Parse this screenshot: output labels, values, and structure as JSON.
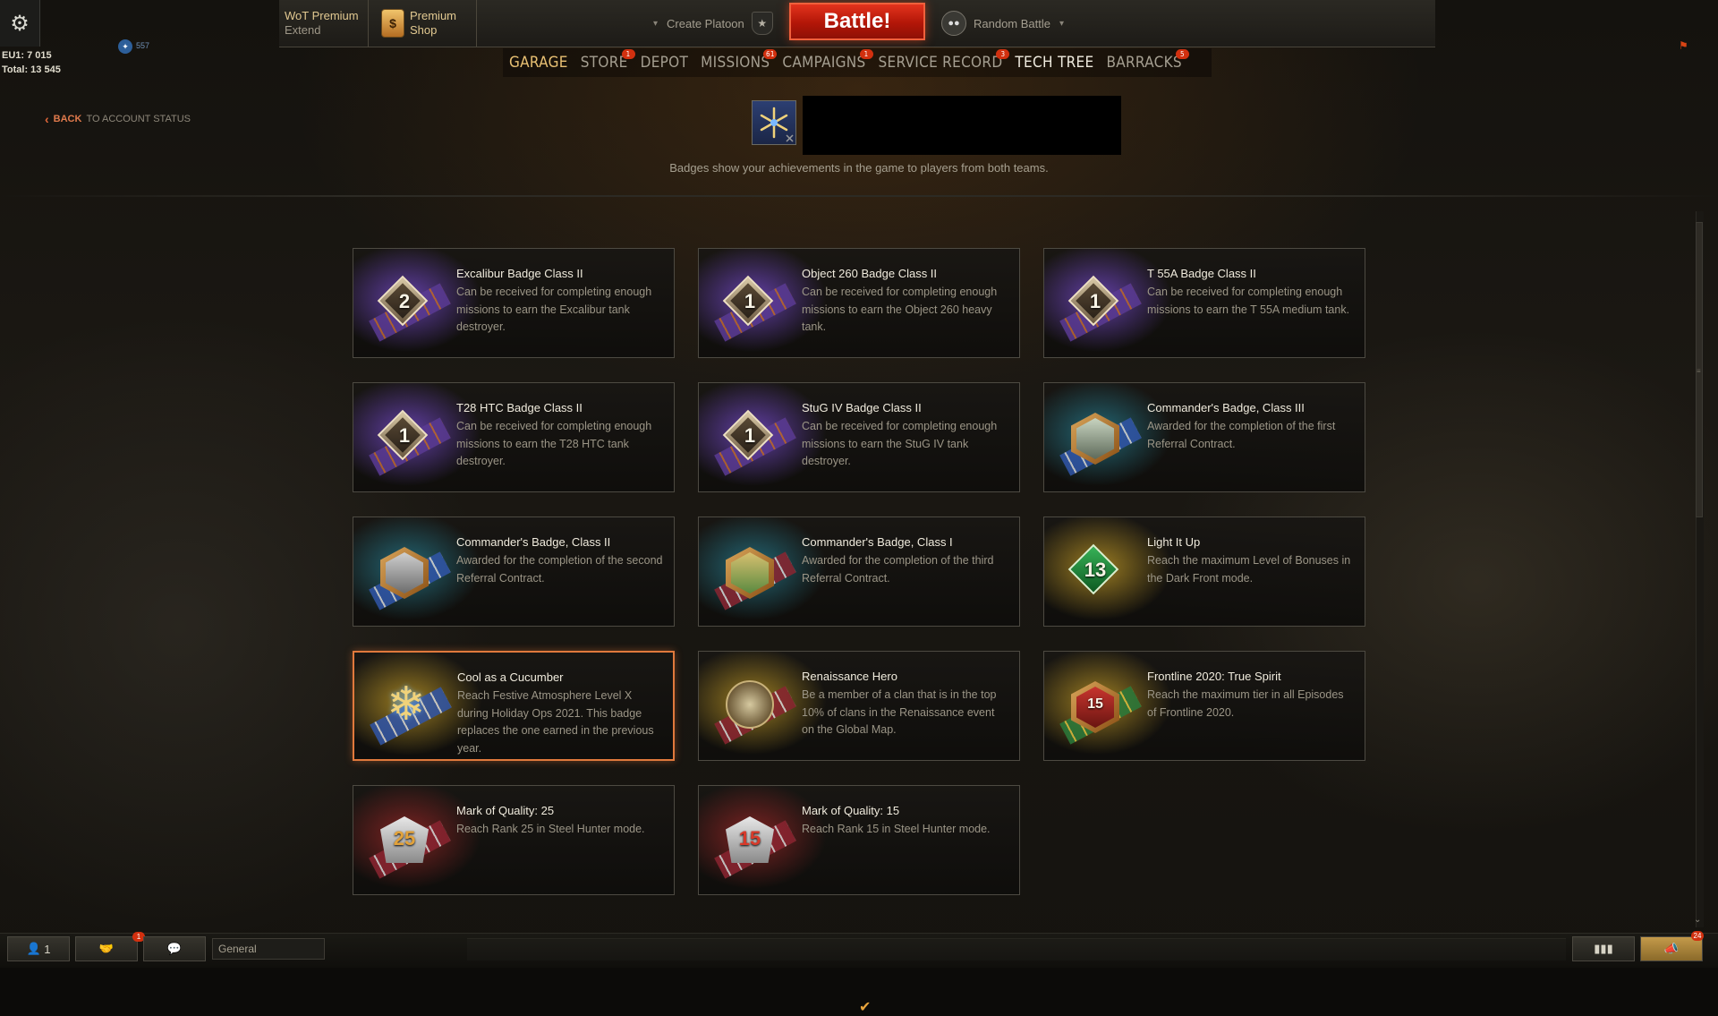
{
  "topbar": {
    "premium": {
      "title": "WoT Premium",
      "sub": "Extend"
    },
    "shop": {
      "title": "Premium",
      "sub": "Shop"
    },
    "platoon_label": "Create Platoon",
    "battle_label": "Battle!",
    "mode_label": "Random Battle"
  },
  "stats": {
    "line1": "EU1: 7 015",
    "line2": "Total: 13 545",
    "xp_value": "557"
  },
  "nav": {
    "items": [
      {
        "label": "GARAGE",
        "badge": ""
      },
      {
        "label": "STORE",
        "badge": "1"
      },
      {
        "label": "DEPOT",
        "badge": ""
      },
      {
        "label": "MISSIONS",
        "badge": "61"
      },
      {
        "label": "CAMPAIGNS",
        "badge": "1"
      },
      {
        "label": "SERVICE RECORD",
        "badge": "3"
      },
      {
        "label": "TECH TREE",
        "badge": ""
      },
      {
        "label": "BARRACKS",
        "badge": "5"
      }
    ]
  },
  "back": {
    "label": "BACK",
    "target": "TO ACCOUNT STATUS"
  },
  "header": {
    "caption": "Badges show your achievements in the game to players from both teams."
  },
  "badges": [
    {
      "title": "Excalibur Badge Class II",
      "desc": "Can be received for completing enough missions to earn the Excalibur tank destroyer.",
      "icon": "rank-2-badge-icon",
      "num": "2"
    },
    {
      "title": "Object 260 Badge Class II",
      "desc": "Can be received for completing enough missions to earn the Object 260 heavy tank.",
      "icon": "rank-1-badge-icon",
      "num": "1"
    },
    {
      "title": "T 55A Badge Class II",
      "desc": "Can be received for completing enough missions to earn the T 55A medium tank.",
      "icon": "rank-1-badge-icon",
      "num": "1"
    },
    {
      "title": "T28 HTC Badge Class II",
      "desc": "Can be received for completing enough missions to earn the T28 HTC tank destroyer.",
      "icon": "rank-1-badge-icon",
      "num": "1"
    },
    {
      "title": "StuG IV Badge Class II",
      "desc": "Can be received for completing enough missions to earn the StuG IV tank destroyer.",
      "icon": "rank-1-badge-icon",
      "num": "1"
    },
    {
      "title": "Commander's Badge, Class III",
      "desc": "Awarded for the completion of the first Referral Contract.",
      "icon": "commander-badge-icon",
      "num": ""
    },
    {
      "title": "Commander's Badge, Class II",
      "desc": "Awarded for the completion of the second Referral Contract.",
      "icon": "commander-badge-icon",
      "num": ""
    },
    {
      "title": "Commander's Badge, Class I",
      "desc": "Awarded for the completion of the third Referral Contract.",
      "icon": "commander-badge-icon",
      "num": ""
    },
    {
      "title": "Light It Up",
      "desc": "Reach the maximum Level of Bonuses in the Dark Front mode.",
      "icon": "light-it-up-badge-icon",
      "num": "13"
    },
    {
      "title": "Cool as a Cucumber",
      "desc": "Reach Festive Atmosphere Level X during Holiday Ops 2021. This badge replaces the one earned in the previous year.",
      "icon": "snowflake-badge-icon",
      "num": ""
    },
    {
      "title": "Renaissance Hero",
      "desc": "Be a member of a clan that is in the top 10% of clans in the Renaissance event on the Global Map.",
      "icon": "renaissance-emblem-icon",
      "num": ""
    },
    {
      "title": "Frontline 2020: True Spirit",
      "desc": "Reach the maximum tier in all Episodes of Frontline 2020.",
      "icon": "frontline-badge-icon",
      "num": "15"
    },
    {
      "title": "Mark of Quality: 25",
      "desc": "Reach Rank 25 in Steel Hunter mode.",
      "icon": "steel-hunter-badge-icon",
      "num": "25"
    },
    {
      "title": "Mark of Quality: 15",
      "desc": "Reach Rank 15 in Steel Hunter mode.",
      "icon": "steel-hunter-badge-icon",
      "num": "15"
    }
  ],
  "bottom": {
    "players_count": "1",
    "invites_badge": "1",
    "chat_channel": "General",
    "notifications_badge": "24"
  }
}
